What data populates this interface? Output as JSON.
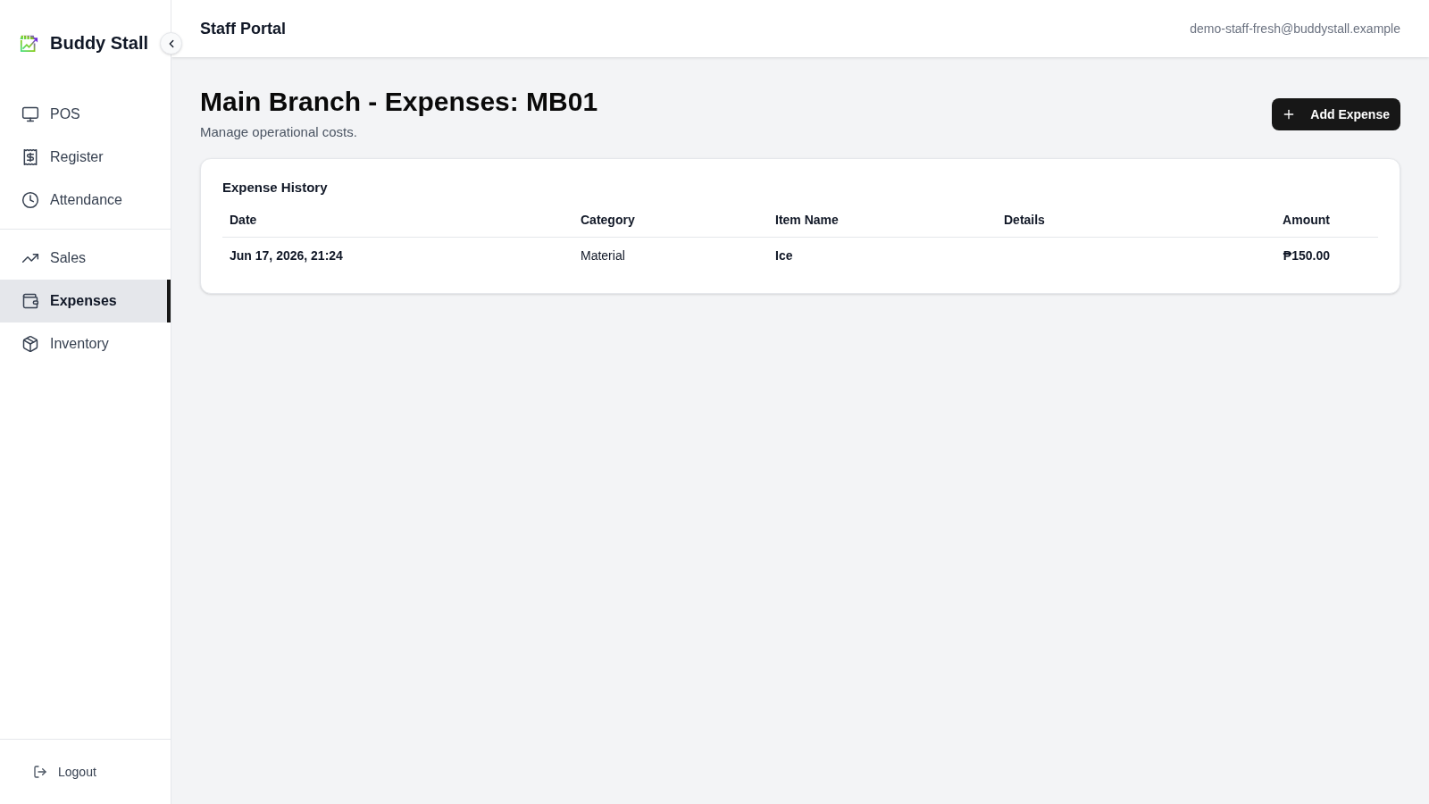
{
  "sidebar": {
    "brand": "Buddy Stall",
    "groups": [
      {
        "items": [
          {
            "label": "POS",
            "selected": false
          },
          {
            "label": "Register",
            "selected": false
          },
          {
            "label": "Attendance",
            "selected": false
          }
        ]
      },
      {
        "items": [
          {
            "label": "Sales",
            "selected": false
          },
          {
            "label": "Expenses",
            "selected": true
          },
          {
            "label": "Inventory",
            "selected": false
          }
        ]
      }
    ],
    "logout": "Logout"
  },
  "header": {
    "title": "Staff Portal",
    "user_email": "demo-staff-fresh@buddystall.example"
  },
  "page": {
    "title": "Main Branch - Expenses: MB01",
    "subtitle": "Manage operational costs.",
    "add_button": "Add Expense"
  },
  "expense_history": {
    "title": "Expense History",
    "columns": [
      "Date",
      "Category",
      "Item Name",
      "Details",
      "Amount"
    ],
    "rows": [
      {
        "date": "Jun 17, 2026, 21:24",
        "category": "Material",
        "item_name": "Ice",
        "amount": "₱150.00"
      }
    ]
  }
}
